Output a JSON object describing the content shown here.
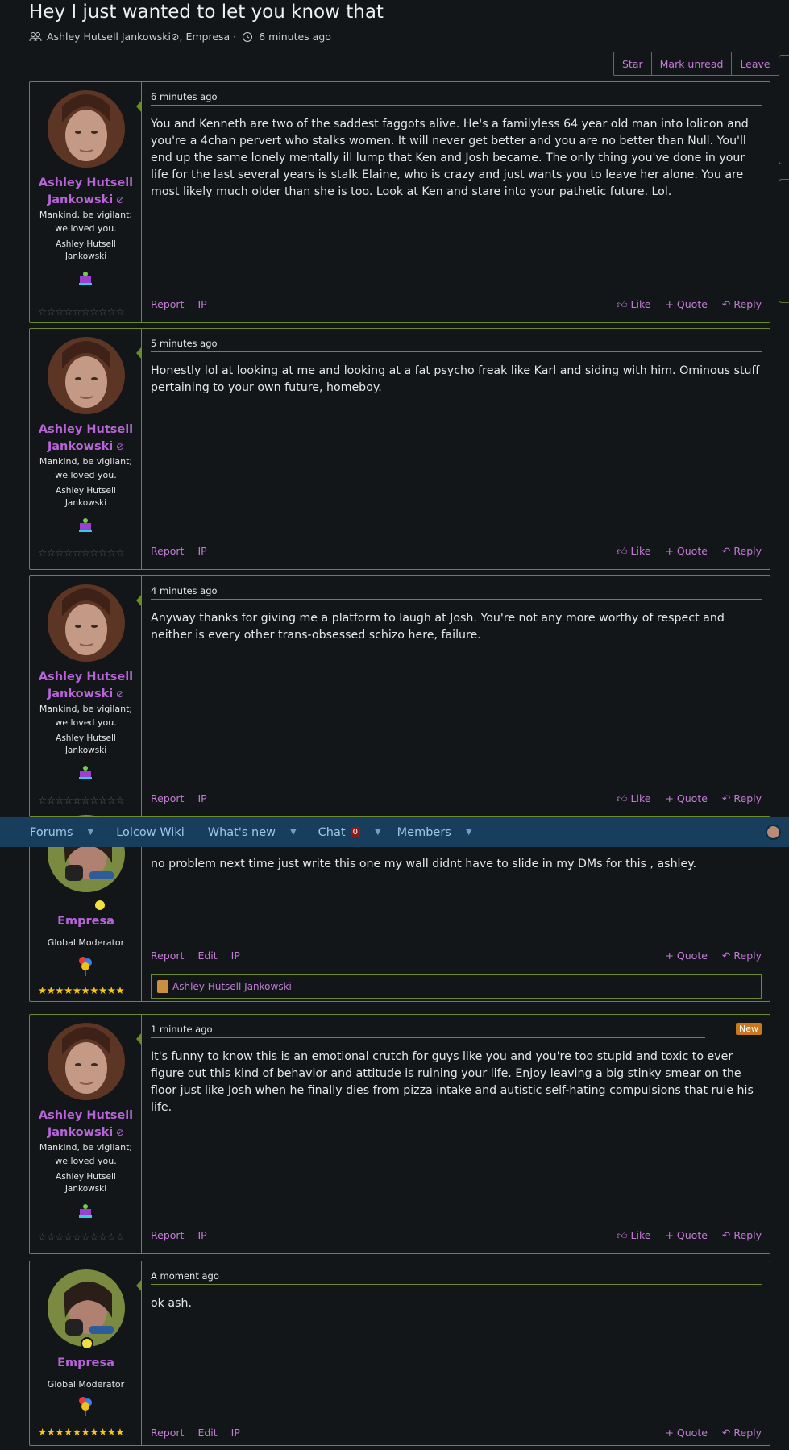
{
  "thread": {
    "title": "Hey I just wanted to let you know that",
    "participants": "Ashley Hutsell Jankowski",
    "participants_rest": ", Empresa · ",
    "time": "6 minutes ago"
  },
  "thread_buttons": [
    "Star",
    "Mark unread",
    "Leave"
  ],
  "nav": {
    "items": [
      "Forums",
      "Lolcow Wiki",
      "What's new",
      "Chat",
      "Members"
    ],
    "chat_count": "0"
  },
  "ashley": {
    "name_line1": "Ashley Hutsell",
    "name_line2": "Jankowski",
    "title_line1": "Mankind, be vigilant;",
    "title_line2": "we loved you.",
    "banner_line1": "Ashley Hutsell",
    "banner_line2": "Jankowski",
    "stars": "☆☆☆☆☆☆☆☆☆☆"
  },
  "empresa": {
    "name": "Empresa",
    "title": "Global Moderator",
    "stars": "★★★★★★★★★★"
  },
  "actions": {
    "report": "Report",
    "edit": "Edit",
    "ip": "IP",
    "like": "Like",
    "quote": "Quote",
    "reply": "Reply"
  },
  "posts": [
    {
      "date": "6 minutes ago",
      "text": "You and Kenneth are two of the saddest faggots alive. He's a familyless 64 year old man into lolicon and you're a 4chan pervert who stalks women. It will never get better and you are no better than Null. You'll end up the same lonely mentally ill lump that Ken and Josh became. The only thing you've done in your life for the last several years is stalk Elaine, who is crazy and just wants you to leave her alone. You are most likely much older than she is too. Look at Ken and stare into your pathetic future. Lol."
    },
    {
      "date": "5 minutes ago",
      "text": "Honestly lol at looking at me and looking at a fat psycho freak like Karl and siding with him. Ominous stuff pertaining to your own future, homeboy."
    },
    {
      "date": "4 minutes ago",
      "text": "Anyway thanks for giving me a platform to laugh at Josh. You're not any more worthy of respect and neither is every other trans-obsessed schizo here, failure."
    },
    {
      "text": "no problem next time just write this one my wall didnt have to slide in my DMs for this , ashley.",
      "reaction_user": "Ashley Hutsell Jankowski"
    },
    {
      "date": "1 minute ago",
      "badge": "New",
      "text": "It's funny to know this is an emotional crutch for guys like you and you're too stupid and toxic to ever figure out this kind of behavior and attitude is ruining your life. Enjoy leaving a big stinky smear on the floor just like Josh when he finally dies from pizza intake and autistic self-hating compulsions that rule his life."
    },
    {
      "date": "A moment ago",
      "text": "ok ash."
    }
  ]
}
